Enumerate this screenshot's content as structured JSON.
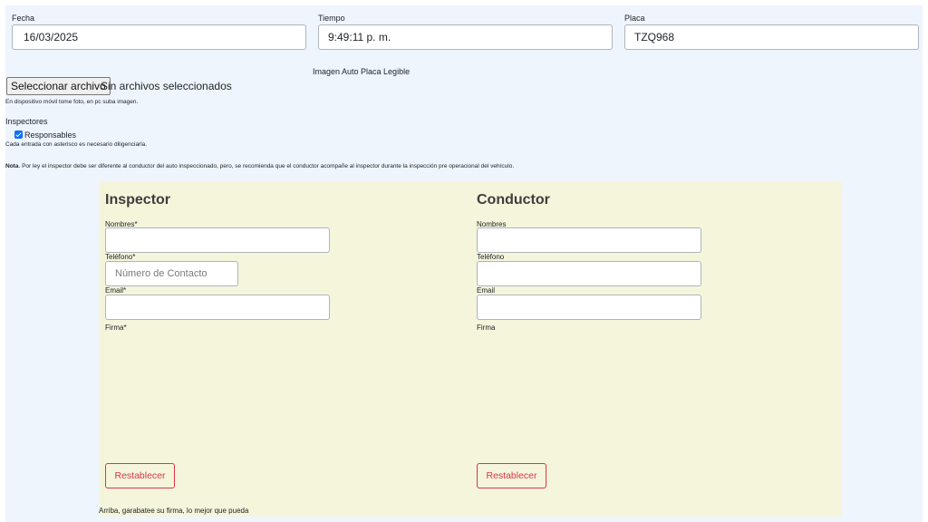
{
  "header": {
    "fecha": {
      "label": "Fecha",
      "value": "16/03/2025"
    },
    "tiempo": {
      "label": "Tiempo",
      "value": "9:49:11 p. m."
    },
    "placa": {
      "label": "Placa",
      "value": "TZQ968"
    }
  },
  "image_upload": {
    "caption": "Imagen Auto Placa Legible",
    "button_label": "Seleccionar archivo",
    "status": "Sin archivos seleccionados",
    "hint": "En dispositivo móvil tome foto, en pc suba imagen."
  },
  "inspectors": {
    "title": "Inspectores",
    "checkbox_label": "Responsables",
    "checked": true,
    "hint": "Cada entrada con asterisco es necesario diligenciarla."
  },
  "note": {
    "bold": "Nota",
    "text": ". Por ley el inspector debe ser diferente al conductor del auto inspeccionado, pero, se recomienda que el conductor acompañe al inspector durante la inspección pre operacional del vehículo."
  },
  "inspector": {
    "title": "Inspector",
    "nombres_label": "Nombres*",
    "nombres_value": "",
    "telefono_label": "Teléfono*",
    "telefono_placeholder": "Número de Contacto",
    "email_label": "Email*",
    "email_value": "",
    "firma_label": "Firma*",
    "reset_label": "Restablecer"
  },
  "conductor": {
    "title": "Conductor",
    "nombres_label": "Nombres",
    "nombres_value": "",
    "telefono_label": "Teléfono",
    "telefono_value": "",
    "email_label": "Email",
    "email_value": "",
    "firma_label": "Firma",
    "reset_label": "Restablecer"
  },
  "signature_hint": "Arriba, garabatee su firma, lo mejor que pueda",
  "colors": {
    "page_bg": "#eef5fc",
    "panel_bg": "#f5f5dc",
    "reset_red": "#dc3545",
    "checkbox_blue": "#0d6efd"
  }
}
